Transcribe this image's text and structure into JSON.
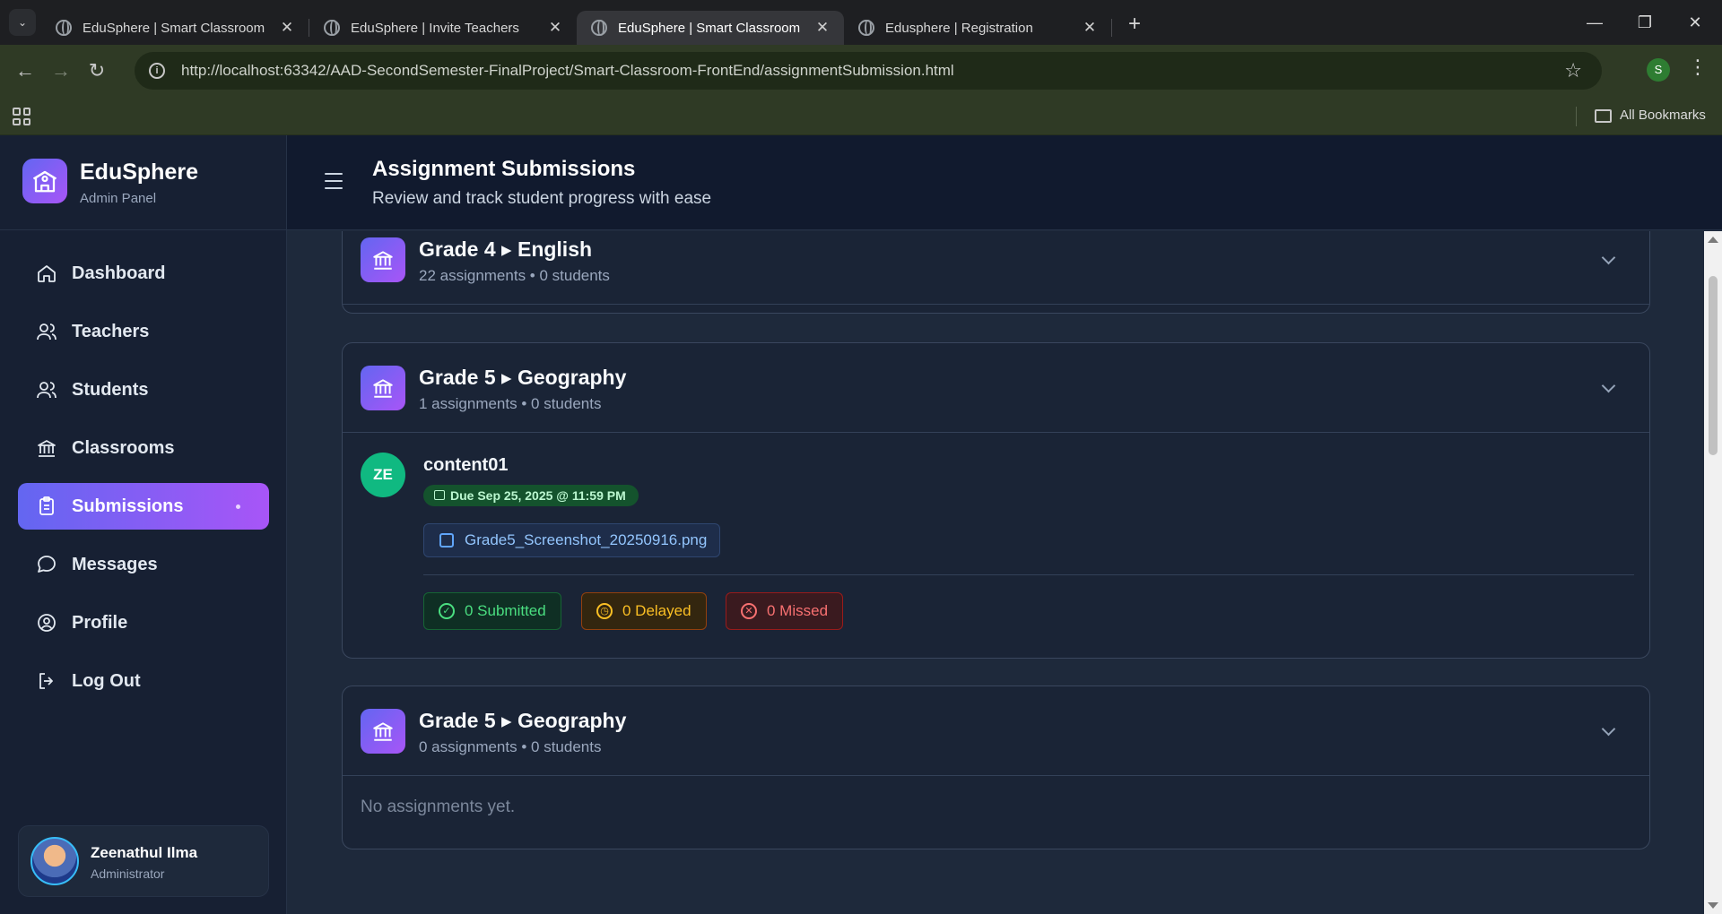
{
  "browser": {
    "tabs": [
      {
        "title": "EduSphere | Smart Classroom",
        "active": false
      },
      {
        "title": "EduSphere | Invite Teachers",
        "active": false
      },
      {
        "title": "EduSphere | Smart Classroom",
        "active": true
      },
      {
        "title": "Edusphere | Registration",
        "active": false
      }
    ],
    "url": "http://localhost:63342/AAD-SecondSemester-FinalProject/Smart-Classroom-FrontEnd/assignmentSubmission.html",
    "profile_initial": "S",
    "all_bookmarks": "All Bookmarks"
  },
  "brand": {
    "name": "EduSphere",
    "subtitle": "Admin Panel"
  },
  "sidebar": {
    "items": [
      {
        "label": "Dashboard",
        "icon": "home-icon"
      },
      {
        "label": "Teachers",
        "icon": "users-icon"
      },
      {
        "label": "Students",
        "icon": "users-icon"
      },
      {
        "label": "Classrooms",
        "icon": "bank-icon"
      },
      {
        "label": "Submissions",
        "icon": "clipboard-icon",
        "active": true
      },
      {
        "label": "Messages",
        "icon": "chat-icon"
      },
      {
        "label": "Profile",
        "icon": "user-circle-icon"
      },
      {
        "label": "Log Out",
        "icon": "logout-icon"
      }
    ]
  },
  "user": {
    "name": "Zeenathul Ilma",
    "role": "Administrator"
  },
  "header": {
    "title": "Assignment Submissions",
    "subtitle": "Review and track student progress with ease"
  },
  "groups": [
    {
      "title": "Grade 4 ▸ English",
      "meta": "22 assignments • 0 students"
    },
    {
      "title": "Grade 5 ▸ Geography",
      "meta": "1 assignments • 0 students",
      "assignment": {
        "initials": "ZE",
        "title": "content01",
        "due": "Due Sep 25, 2025 @ 11:59 PM",
        "file": "Grade5_Screenshot_20250916.png",
        "submitted": "0 Submitted",
        "delayed": "0 Delayed",
        "missed": "0 Missed"
      }
    },
    {
      "title": "Grade 5 ▸ Geography",
      "meta": "0 assignments • 0 students",
      "empty": "No assignments yet."
    }
  ],
  "colors": {
    "accent_start": "#6366f1",
    "accent_end": "#a855f7",
    "submitted": "#4ade80",
    "delayed": "#fbbf24",
    "missed": "#f87171"
  }
}
